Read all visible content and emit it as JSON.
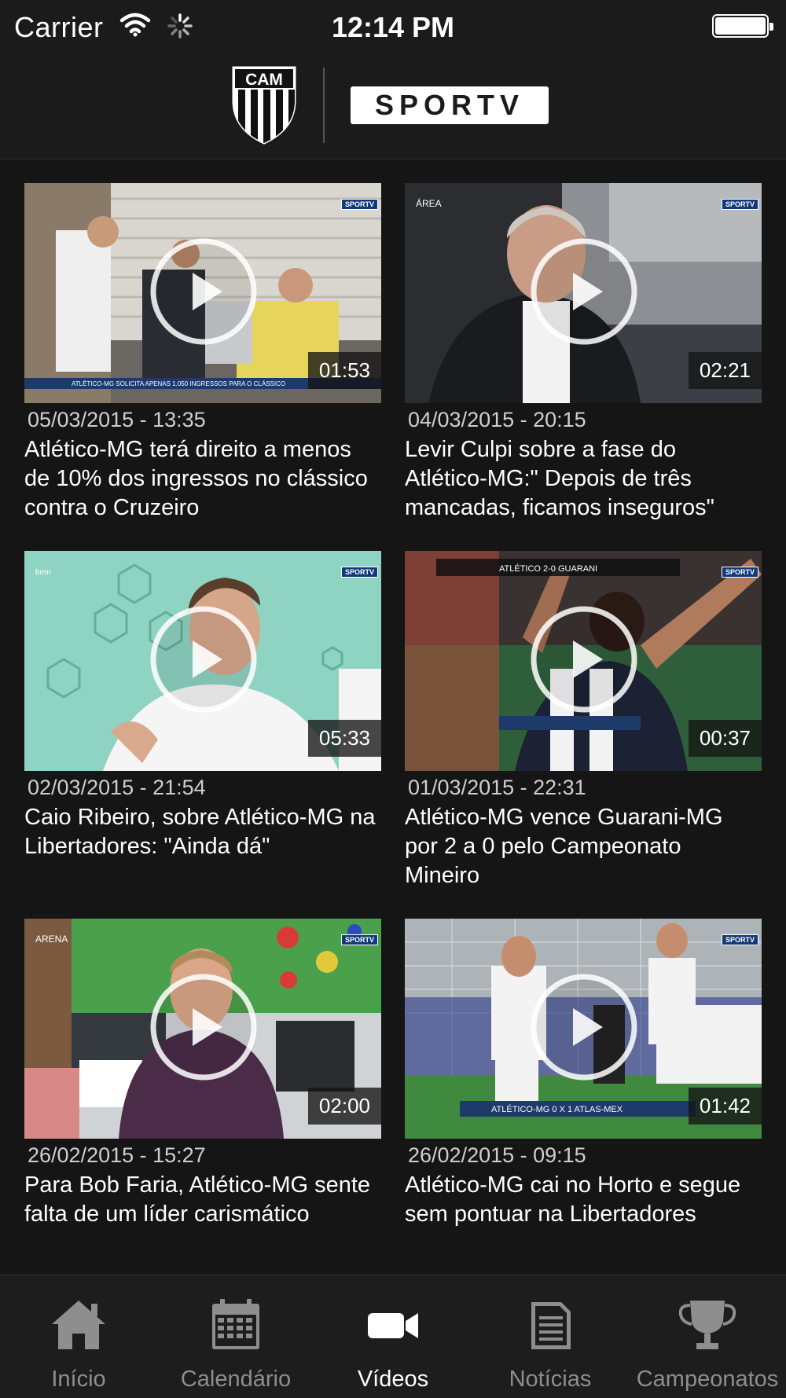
{
  "status_bar": {
    "carrier": "Carrier",
    "time": "12:14 PM"
  },
  "header": {
    "crest_text": "CAM",
    "partner_logo_text": "SPORTV"
  },
  "videos": [
    {
      "date": "05/03/2015 - 13:35",
      "title": "Atlético-MG terá direito a menos de 10% dos ingressos no clássico contra o Cruzeiro",
      "duration": "01:53"
    },
    {
      "date": "04/03/2015 - 20:15",
      "title": "Levir Culpi sobre a fase do Atlético-MG:\" Depois de três mancadas, ficamos inseguros\"",
      "duration": "02:21"
    },
    {
      "date": "02/03/2015 - 21:54",
      "title": "Caio Ribeiro, sobre Atlético-MG na Libertadores: \"Ainda dá\"",
      "duration": "05:33"
    },
    {
      "date": "01/03/2015 - 22:31",
      "title": "Atlético-MG vence Guarani-MG por 2 a 0 pelo Campeonato Mineiro",
      "duration": "00:37"
    },
    {
      "date": "26/02/2015 - 15:27",
      "title": "Para Bob Faria, Atlético-MG sente falta de um líder carismático",
      "duration": "02:00"
    },
    {
      "date": "26/02/2015 - 09:15",
      "title": "Atlético-MG cai no Horto e segue sem pontuar na Libertadores",
      "duration": "01:42"
    }
  ],
  "tabs": [
    {
      "label": "Início",
      "icon": "home-icon"
    },
    {
      "label": "Calendário",
      "icon": "calendar-icon"
    },
    {
      "label": "Vídeos",
      "icon": "video-camera-icon",
      "active": true
    },
    {
      "label": "Notícias",
      "icon": "news-icon"
    },
    {
      "label": "Campeonatos",
      "icon": "trophy-icon"
    }
  ],
  "colors": {
    "background": "#151515",
    "bar": "#1b1b1b",
    "tab_inactive": "#8e8e8e",
    "tab_active": "#ffffff"
  }
}
